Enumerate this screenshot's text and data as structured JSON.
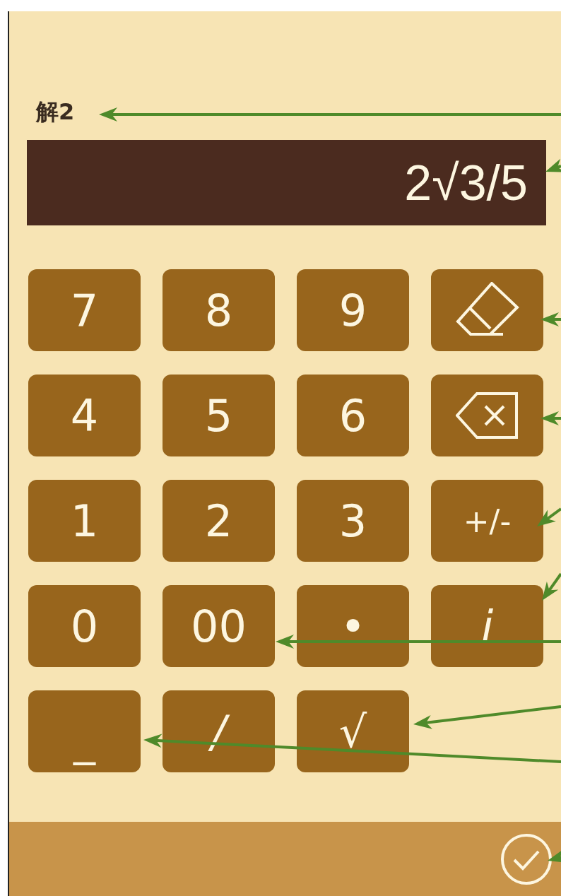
{
  "label": "解2",
  "display": {
    "value": "2√3/5"
  },
  "keypad": [
    [
      {
        "kind": "text",
        "label": "7"
      },
      {
        "kind": "text",
        "label": "8"
      },
      {
        "kind": "text",
        "label": "9"
      },
      {
        "kind": "eraser"
      }
    ],
    [
      {
        "kind": "text",
        "label": "4"
      },
      {
        "kind": "text",
        "label": "5"
      },
      {
        "kind": "text",
        "label": "6"
      },
      {
        "kind": "backspace"
      }
    ],
    [
      {
        "kind": "text",
        "label": "1"
      },
      {
        "kind": "text",
        "label": "2"
      },
      {
        "kind": "text",
        "label": "3"
      },
      {
        "kind": "text",
        "label": "+/-"
      }
    ],
    [
      {
        "kind": "text",
        "label": "0"
      },
      {
        "kind": "text",
        "label": "00"
      },
      {
        "kind": "text",
        "label": "•"
      },
      {
        "kind": "italic",
        "label": "i"
      }
    ],
    [
      {
        "kind": "low",
        "label": "_"
      },
      {
        "kind": "italic",
        "label": "/"
      },
      {
        "kind": "text",
        "label": "√"
      }
    ]
  ]
}
